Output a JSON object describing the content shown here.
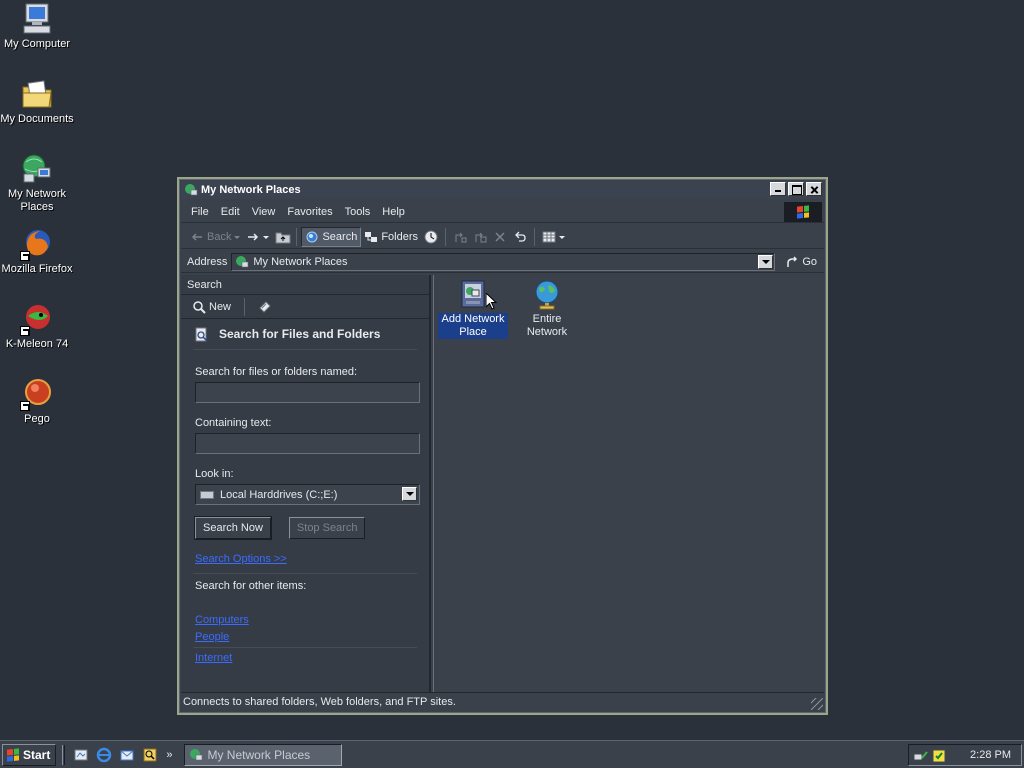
{
  "desktop": {
    "icons": [
      {
        "label": "My Computer",
        "icon": "my-computer-icon"
      },
      {
        "label": "My Documents",
        "icon": "my-documents-icon"
      },
      {
        "label": "My Network Places",
        "icon": "network-places-icon"
      },
      {
        "label": "Mozilla Firefox",
        "icon": "firefox-icon"
      },
      {
        "label": "K-Meleon 74",
        "icon": "k-meleon-icon"
      },
      {
        "label": "Pego",
        "icon": "pego-icon"
      }
    ]
  },
  "window": {
    "title": "My Network Places",
    "menu": [
      "File",
      "Edit",
      "View",
      "Favorites",
      "Tools",
      "Help"
    ],
    "toolbar": {
      "back": "Back",
      "search": "Search",
      "folders": "Folders"
    },
    "address": {
      "label": "Address",
      "value": "My Network Places",
      "go": "Go"
    },
    "search_pane": {
      "header": "Search",
      "new_label": "New",
      "title": "Search for Files and Folders",
      "named_label": "Search for files or folders named:",
      "named_value": "",
      "containing_label": "Containing text:",
      "containing_value": "",
      "look_in_label": "Look in:",
      "look_in_value": "Local Harddrives (C:;E:)",
      "search_now": "Search Now",
      "stop_search": "Stop Search",
      "search_options": "Search Options >>",
      "other_items_label": "Search for other items:",
      "links": [
        "Computers",
        "People",
        "Internet"
      ]
    },
    "items": [
      {
        "label": "Add Network Place",
        "icon": "add-network-place-icon",
        "selected": true
      },
      {
        "label": "Entire Network",
        "icon": "globe-icon",
        "selected": false
      }
    ],
    "status": "Connects to shared folders, Web folders, and FTP sites."
  },
  "taskbar": {
    "start": "Start",
    "quick_launch_chevron": "»",
    "task": "My Network Places",
    "clock": "2:28 PM"
  },
  "colors": {
    "desktop": "#2a313b",
    "window_border": "#9aa58a",
    "selection": "#1b3f8a",
    "link": "#3a6cff"
  }
}
